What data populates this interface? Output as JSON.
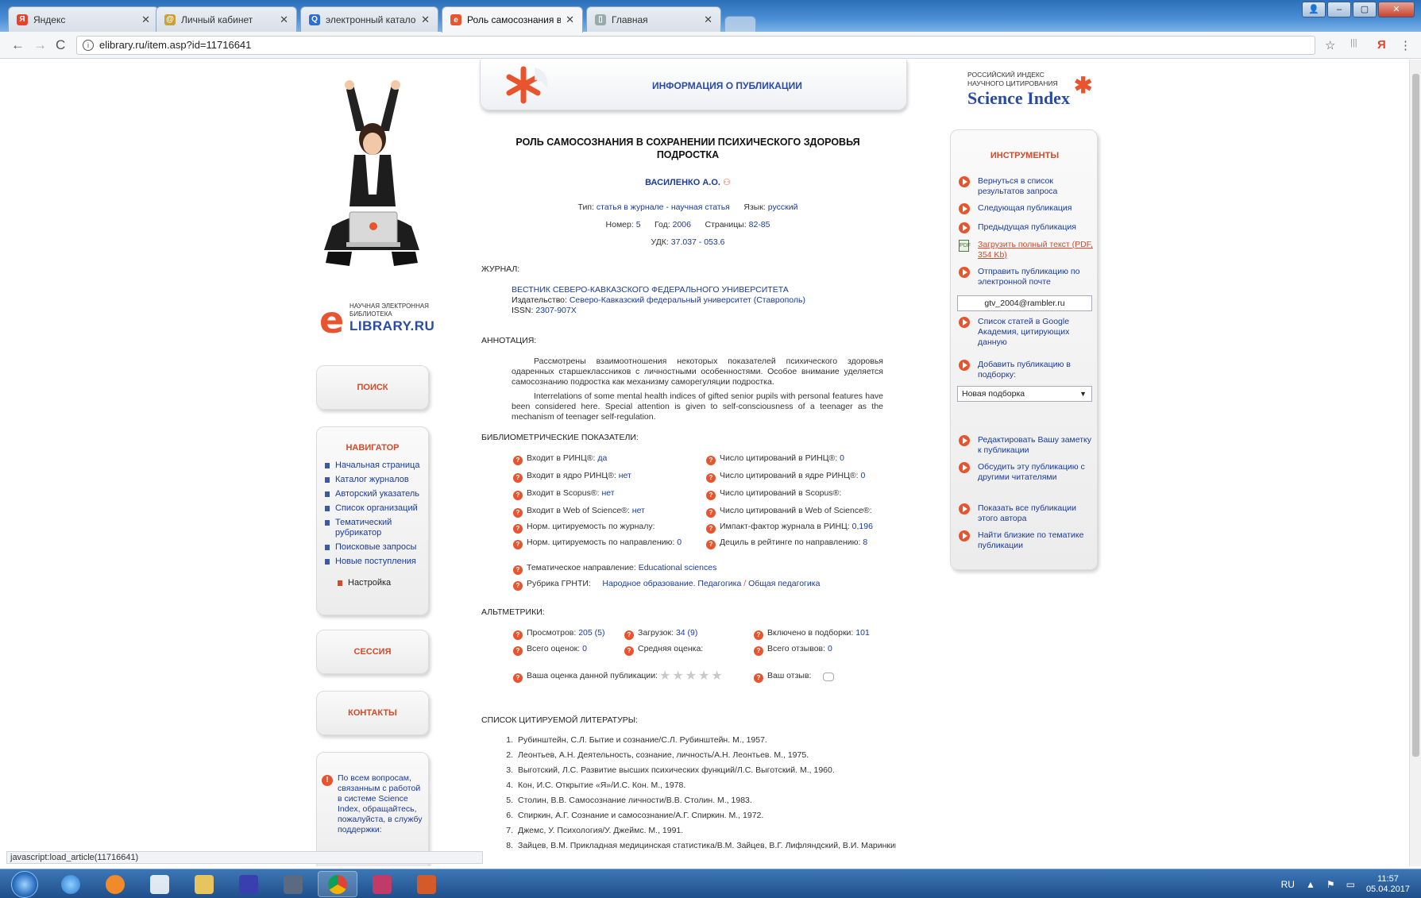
{
  "browser": {
    "tabs": [
      {
        "label": "Яндекс",
        "fav": "Я",
        "color": "#e8412c"
      },
      {
        "label": "Личный кабинет",
        "fav": "@",
        "color": "#c9a13a"
      },
      {
        "label": "электронный каталог РГ",
        "fav": "Q",
        "color": "#2a6fd1"
      },
      {
        "label": "Роль самосознания в со",
        "fav": "e",
        "color": "#e8542e"
      },
      {
        "label": "Главная",
        "fav": "▯",
        "color": "#9aa"
      }
    ],
    "close_glyph": "✕",
    "url": "elibrary.ru/item.asp?id=11716641",
    "back": "←",
    "forward": "→",
    "reload": "C",
    "info": "i",
    "star": "☆",
    "menu": "⋮",
    "yandex_icon": "Я",
    "bookmarks_icon": "|||",
    "status_url": "javascript:load_article(11716641)"
  },
  "left": {
    "logo_small": "НАУЧНАЯ ЭЛЕКТРОННАЯ\nБИБЛИОТЕКА",
    "logo_e": "e",
    "logo_big": "LIBRARY.RU",
    "search_label": "ПОИСК",
    "navigator_title": "НАВИГАТОР",
    "nav_items": [
      "Начальная страница",
      "Каталог журналов",
      "Авторский указатель",
      "Список организаций",
      "Тематический рубрикатор",
      "Поисковые запросы",
      "Новые поступления"
    ],
    "settings_label": "Настройка",
    "session_label": "СЕССИЯ",
    "contacts_label": "КОНТАКТЫ",
    "help_text": "По всем вопросам, связанным с работой в системе Science Index, обращайтесь, пожалуйста, в службу поддержки:",
    "help_icon": "!"
  },
  "banner": {
    "title": "ИНФОРМАЦИЯ О ПУБЛИКАЦИИ"
  },
  "article": {
    "title": "РОЛЬ САМОСОЗНАНИЯ В СОХРАНЕНИИ ПСИХИЧЕСКОГО ЗДОРОВЬЯ ПОДРОСТКА",
    "author": "ВАСИЛЕНКО А.О.",
    "author_mark": "⚇",
    "type_label": "Тип:",
    "type_value": "статья в журнале - научная статья",
    "lang_label": "Язык:",
    "lang_value": "русский",
    "issue_label": "Номер:",
    "issue_value": "5",
    "year_label": "Год:",
    "year_value": "2006",
    "pages_label": "Страницы:",
    "pages_value": "82-85",
    "udk_label": "УДК:",
    "udk_value": "37.037 - 053.6",
    "journal_heading": "ЖУРНАЛ:",
    "journal_name": "ВЕСТНИК СЕВЕРО-КАВКАЗСКОГО ФЕДЕРАЛЬНОГО УНИВЕРСИТЕТА",
    "publisher_label": "Издательство:",
    "publisher_value": "Северо-Кавказский федеральный университет (Ставрополь)",
    "issn_label": "ISSN:",
    "issn_value": "2307-907X",
    "annotation_heading": "АННОТАЦИЯ:",
    "abstract_ru": "Рассмотрены взаимоотношения некоторых показателей психического здоровья одаренных старшеклассников с личностными особенностями. Особое внимание уделяется самосознанию подростка как механизму саморегуляции подростка.",
    "abstract_en": "Interrelations of some mental health indices of gifted senior pupils with personal features have been considered here. Special attention is given to self-consciousness of a teenager as the mechanism of teenager self-regulation."
  },
  "bibliometrics": {
    "heading": "БИБЛИОМЕТРИЧЕСКИЕ ПОКАЗАТЕЛИ:",
    "left": [
      {
        "label": "Входит в РИНЦ®:",
        "value": "да"
      },
      {
        "label": "Входит в ядро РИНЦ®:",
        "value": "нет"
      },
      {
        "label": "Входит в Scopus®:",
        "value": "нет"
      },
      {
        "label": "Входит в Web of Science®:",
        "value": "нет"
      },
      {
        "label": "Норм. цитируемость по журналу:",
        "value": ""
      },
      {
        "label": "Норм. цитируемость по направлению:",
        "value": "0"
      }
    ],
    "right": [
      {
        "label": "Число цитирований в РИНЦ®:",
        "value": "0"
      },
      {
        "label": "Число цитирований в ядре РИНЦ®:",
        "value": "0"
      },
      {
        "label": "Число цитирований в Scopus®:",
        "value": ""
      },
      {
        "label": "Число цитирований в Web of Science®:",
        "value": ""
      },
      {
        "label": "Импакт-фактор журнала в РИНЦ:",
        "value": "0,196"
      },
      {
        "label": "Дециль в рейтинге по направлению:",
        "value": "8"
      }
    ],
    "topic_label": "Тематическое направление:",
    "topic_value": "Educational sciences",
    "grnti_label": "Рубрика ГРНТИ:",
    "grnti_value1": "Народное образование. Педагогика",
    "grnti_sep": "/",
    "grnti_value2": "Общая педагогика"
  },
  "altmetrics": {
    "heading": "АЛЬТМЕТРИКИ:",
    "views_label": "Просмотров:",
    "views_value": "205 (5)",
    "downloads_label": "Загрузок:",
    "downloads_value": "34 (9)",
    "collections_label": "Включено в подборки:",
    "collections_value": "101",
    "ratings_label": "Всего оценок:",
    "ratings_value": "0",
    "avg_label": "Средняя оценка:",
    "reviews_label": "Всего отзывов:",
    "reviews_value": "0",
    "your_rating_label": "Ваша оценка данной публикации:",
    "your_review_label": "Ваш отзыв:",
    "stars": "★★★★★"
  },
  "references": {
    "heading": "СПИСОК ЦИТИРУЕМОЙ ЛИТЕРАТУРЫ:",
    "items": [
      "Рубинштейн, С.Л. Бытие и сознание/С.Л. Рубинштейн. М., 1957.",
      "Леонтьев, А.Н. Деятельность, сознание, личность/А.Н. Леонтьев. М., 1975.",
      "Выготский, Л.С. Развитие высших психических функций/Л.С. Выготский. М., 1960.",
      "Кон, И.С. Открытие «Я»/И.С. Кон. М., 1978.",
      "Столин, В.В. Самосознание личности/В.В. Столин. М., 1983.",
      "Спиркин, А.Г. Сознание и самосознание/А.Г. Спиркин. М., 1972.",
      "Джемс, У. Психология/У. Джеймс. М., 1991.",
      "Зайцев, В.М. Прикладная медицинская статистика/В.М. Зайцев, В.Г. Лифляндский, В.И. Маринкин."
    ]
  },
  "right": {
    "science_small": "РОССИЙСКИЙ ИНДЕКС\nНАУЧНОГО ЦИТИРОВАНИЯ",
    "science_big": "Science Index",
    "science_ast": "✱",
    "tools_title": "ИНСТРУМЕНТЫ",
    "back_to_results": "Вернуться в список результатов запроса",
    "next_pub": "Следующая публикация",
    "prev_pub": "Предыдущая публикация",
    "download_full": "Загрузить полный текст (PDF, 354 Kb)",
    "send_email": "Отправить публикацию по электронной почте",
    "email_value": "gtv_2004@rambler.ru",
    "google_scholar": "Список статей в Google Академия, цитирующих данную",
    "add_to_collection": "Добавить публикацию в подборку:",
    "collection_select": "Новая подборка",
    "edit_note": "Редактировать Вашу заметку к публикации",
    "discuss": "Обсудить эту публикацию с другими читателями",
    "show_author_pubs": "Показать все публикации этого автора",
    "find_similar": "Найти близкие по тематике публикации",
    "pdf_glyph": "PDF"
  },
  "taskbar": {
    "lang": "RU",
    "time": "11:57",
    "date": "05.04.2017",
    "tray_up": "▲",
    "flag": "⚑"
  }
}
